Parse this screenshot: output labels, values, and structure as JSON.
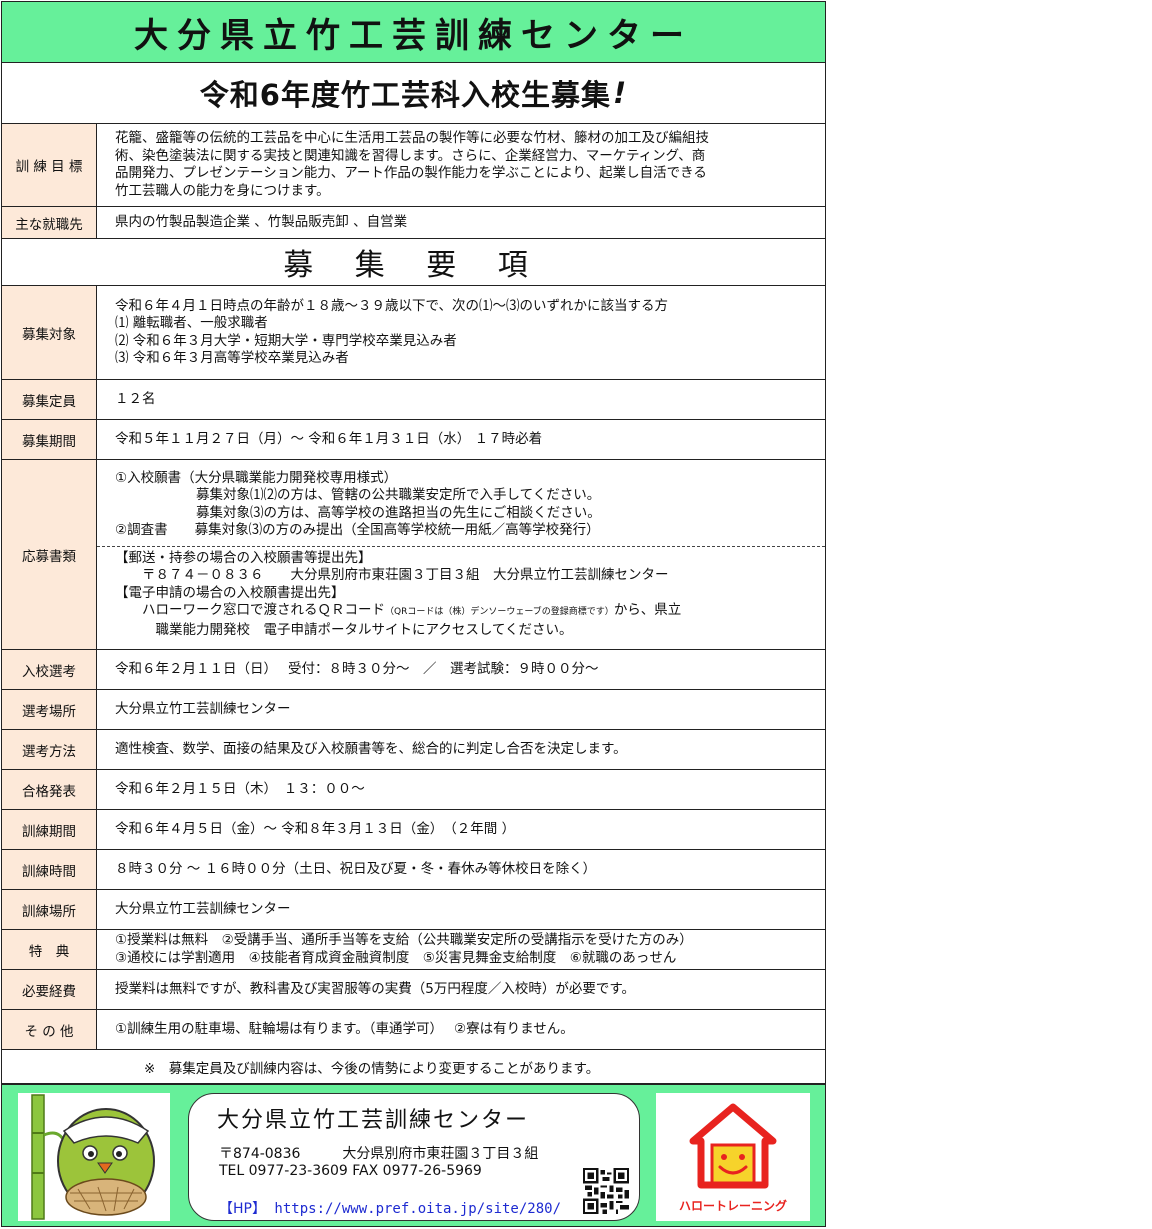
{
  "header": {
    "title": "大分県立竹工芸訓練センター",
    "subtitle": "令和6年度竹工芸科入校生募集",
    "subtitle_mark": "!"
  },
  "goal": {
    "label": "訓 練 目 標",
    "lines": [
      "花籠、盛籠等の伝統的工芸品を中心に生活用工芸品の製作等に必要な竹材、籐材の加工及び編組技",
      "術、染色塗装法に関する実技と関連知識を習得します。さらに、企業経営力、マーケティング、商",
      "品開発力、プレゼンテーション能力、アート作品の製作能力を学ぶことにより、起業し自活できる",
      "竹工芸職人の能力を身につけます。"
    ]
  },
  "jobs": {
    "label": "主な就職先",
    "value": "県内の竹製品製造企業 、竹製品販売卸 、自営業"
  },
  "section_title": "募 集 要 項",
  "target": {
    "label": "募集対象",
    "lines": [
      "令和６年４月１日時点の年齢が１８歳～３９歳以下で、次の⑴～⑶のいずれかに該当する方",
      "⑴ 離転職者、一般求職者",
      "⑵ 令和６年３月大学・短期大学・専門学校卒業見込み者",
      "⑶ 令和６年３月高等学校卒業見込み者"
    ]
  },
  "capacity": {
    "label": "募集定員",
    "value": "１２名"
  },
  "period": {
    "label": "募集期間",
    "value": "令和５年１１月２７日（月）～ 令和６年１月３１日（水） １７時必着"
  },
  "documents": {
    "label": "応募書類",
    "lines": [
      "①入校願書（大分県職業能力開発校専用様式）",
      "　　　　　　募集対象⑴⑵の方は、管轄の公共職業安定所で入手してください。",
      "　　　　　　募集対象⑶の方は、高等学校の進路担当の先生にご相談ください。",
      "②調査書　　募集対象⑶の方のみ提出（全国高等学校統一用紙／高等学校発行）"
    ],
    "post_lines": [
      "【郵送・持参の場合の入校願書等提出先】",
      "　　〒８７４－０８３６　　大分県別府市東荘園３丁目３組　大分県立竹工芸訓練センター",
      "【電子申請の場合の入校願書提出先】",
      "　　ハローワーク窓口で渡されるＱＲコード",
      "（QRコードは（株）デンソーウェーブの登録商標です）",
      "から、県立",
      "　　　職業能力開発校　電子申請ポータルサイトにアクセスしてください。"
    ]
  },
  "exam": {
    "label": "入校選考",
    "value": "令和６年２月１１日（日）　 受付：８時３０分～　／　選考試験：９時００分～"
  },
  "exam_place": {
    "label": "選考場所",
    "value": "大分県立竹工芸訓練センター"
  },
  "exam_method": {
    "label": "選考方法",
    "value": "適性検査、数学、面接の結果及び入校願書等を、総合的に判定し合否を決定します。"
  },
  "result": {
    "label": "合格発表",
    "value": "令和６年２月１５日（木）　１３：００～"
  },
  "train_period": {
    "label": "訓練期間",
    "value": "令和６年４月５日（金）～ 令和８年３月１３日（金）　（２年間 ）"
  },
  "train_hours": {
    "label": "訓練時間",
    "value": "８時３０分 ～ １６時００分（土日、祝日及び夏・冬・春休み等休校日を除く）"
  },
  "train_place": {
    "label": "訓練場所",
    "value": "大分県立竹工芸訓練センター"
  },
  "benefits": {
    "label": "特　典",
    "lines": [
      "①授業料は無料　②受講手当、通所手当等を支給（公共職業安定所の受講指示を受けた方のみ）",
      "③通校には学割適用　④技能者育成資金融資制度　⑤災害見舞金支給制度　⑥就職のあっせん"
    ]
  },
  "costs": {
    "label": "必要経費",
    "value": "授業料は無料ですが、教科書及び実習服等の実費（5万円程度／入校時）が必要です。"
  },
  "other": {
    "label": "そ の 他",
    "value": "①訓練生用の駐車場、駐輪場は有ります。（車通学可）　 ②寮は有りません。"
  },
  "note": "※　募集定員及び訓練内容は、今後の情勢により変更することがあります。",
  "footer": {
    "org_name": "大分県立竹工芸訓練センター",
    "address_line": "〒874-0836　　　大分県別府市東荘園３丁目３組",
    "phone_line": "TEL 0977-23-3609 FAX 0977-26-5969",
    "hp_tag": "【HP】",
    "hp_url": "https://www.pref.oita.jp/site/280/",
    "logo_text": "ハロートレーニング",
    "icons": [
      "mascot-illustration",
      "qr-code",
      "hello-training-logo"
    ],
    "colors": {
      "banner": "#66f09a",
      "label_bg": "#fde9d9",
      "hp_link": "#1e2bd1",
      "logo": "#e8231f"
    }
  }
}
